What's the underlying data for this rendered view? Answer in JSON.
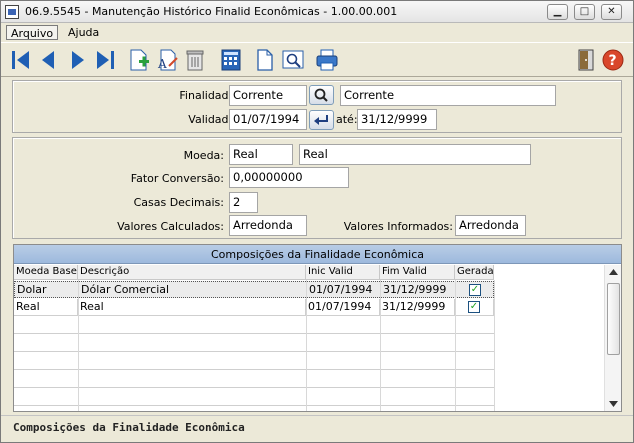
{
  "window": {
    "title": "06.9.5545 - Manutenção Histórico Finalid Econômicas - 1.00.00.001",
    "minimize_glyph": "▁",
    "maximize_glyph": "□",
    "close_glyph": "✕"
  },
  "menu": [
    {
      "label": "Arquivo"
    },
    {
      "label": "Ajuda"
    }
  ],
  "toolbar": {
    "icons": [
      "first-record-icon",
      "previous-record-icon",
      "next-record-icon",
      "last-record-icon",
      "add-icon",
      "edit-icon",
      "delete-icon",
      "calculator-icon",
      "document-icon",
      "zoom-icon",
      "print-icon",
      "exit-icon",
      "help-icon"
    ]
  },
  "form": {
    "finalidade_label": "Finalidade:",
    "finalidade_code": "Corrente",
    "finalidade_desc": "Corrente",
    "validade_label": "Validade:",
    "validade_inicio": "01/07/1994",
    "ate_label": "até:",
    "validade_fim": "31/12/9999",
    "moeda_label": "Moeda:",
    "moeda_code": "Real",
    "moeda_desc": "Real",
    "fator_label": "Fator Conversão:",
    "fator_value": "0,00000000",
    "casas_label": "Casas Decimais:",
    "casas_value": "2",
    "valores_calc_label": "Valores Calculados:",
    "valores_calc_value": "Arredonda",
    "valores_inf_label": "Valores Informados:",
    "valores_inf_value": "Arredonda"
  },
  "grid": {
    "title": "Composições da Finalidade Econômica",
    "columns": [
      "Moeda Base",
      "Descrição",
      "Inic Valid",
      "Fim Valid",
      "Gerada"
    ],
    "rows": [
      {
        "moeda": "Dolar",
        "descricao": "Dólar Comercial",
        "inic": "01/07/1994",
        "fim": "31/12/9999",
        "gerada": "✓"
      },
      {
        "moeda": "Real",
        "descricao": "Real",
        "inic": "01/07/1994",
        "fim": "31/12/9999",
        "gerada": "✓"
      }
    ]
  },
  "status": {
    "text": "Composições da Finalidade Econômica"
  },
  "colors": {
    "window_bg": "#ece9d8",
    "grid_title_bg": "#9db9dd",
    "accent_blue": "#1f5fb4",
    "help_red": "#d9472b"
  }
}
